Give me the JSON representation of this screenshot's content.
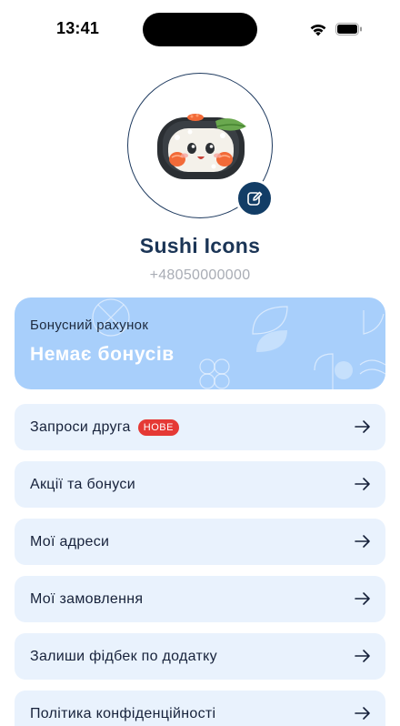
{
  "status_bar": {
    "time": "13:41"
  },
  "profile": {
    "name": "Sushi Icons",
    "phone": "+48050000000",
    "avatar_icon": "sushi-roll-mascot",
    "edit_icon": "edit-pencil-icon"
  },
  "bonus": {
    "label": "Бонусний рахунок",
    "value": "Немає бонусів",
    "background_color": "#a8cffb"
  },
  "menu": {
    "items": [
      {
        "label": "Запроси друга",
        "badge": "НОВЕ"
      },
      {
        "label": "Акції та бонуси"
      },
      {
        "label": "Мої адреси"
      },
      {
        "label": "Мої замовлення"
      },
      {
        "label": "Залиши фідбек по додатку"
      },
      {
        "label": "Політика конфіденційності"
      }
    ]
  },
  "colors": {
    "accent_dark": "#123d66",
    "menu_background": "#e9f2fd",
    "badge": "#e53935"
  }
}
